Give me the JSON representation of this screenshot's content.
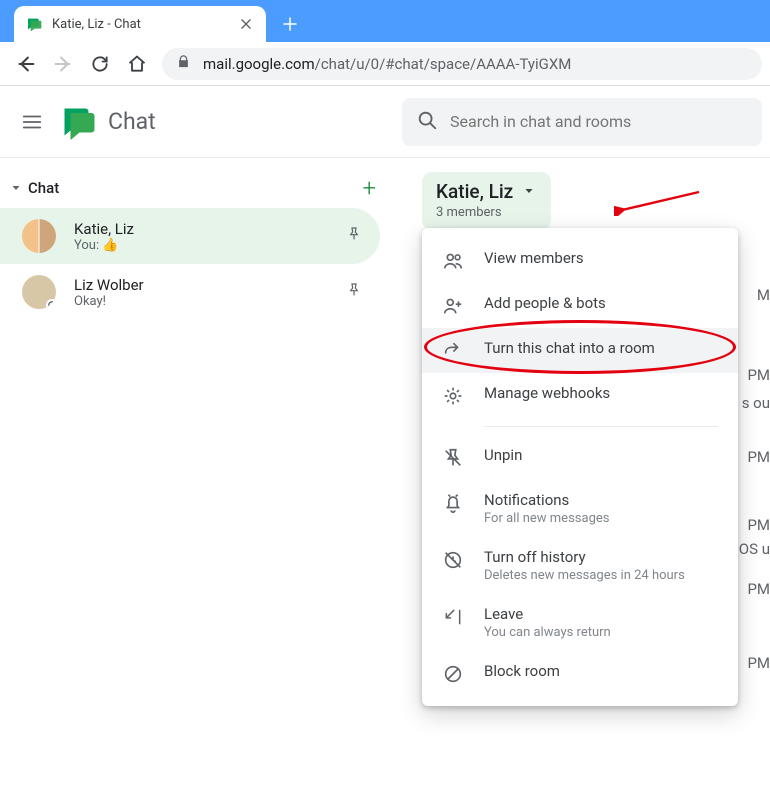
{
  "browser": {
    "tab_title": "Katie, Liz - Chat",
    "url_host": "mail.google.com",
    "url_path": "/chat/u/0/#chat/space/AAAA-TyiGXM"
  },
  "app": {
    "name": "Chat",
    "search_placeholder": "Search in chat and rooms"
  },
  "sidebar": {
    "section_title": "Chat",
    "items": [
      {
        "name": "Katie, Liz",
        "preview": "You: 👍"
      },
      {
        "name": "Liz Wolber",
        "preview": "Okay!"
      }
    ]
  },
  "room": {
    "name": "Katie, Liz",
    "subtitle": "3 members"
  },
  "menu": {
    "view_members": "View members",
    "add": "Add people & bots",
    "turn": "Turn this chat into a room",
    "webhooks": "Manage webhooks",
    "unpin": "Unpin",
    "notif": "Notifications",
    "notif_sub": "For all new messages",
    "history": "Turn off history",
    "history_sub": "Deletes new messages in 24 hours",
    "leave": "Leave",
    "leave_sub": "You can always return",
    "block": "Block room"
  },
  "peek": {
    "a": "M",
    "b": "PM",
    "c": "s ou",
    "d": "PM",
    "e": "PM",
    "f": "OS u",
    "g": "PM",
    "h": "PM"
  }
}
